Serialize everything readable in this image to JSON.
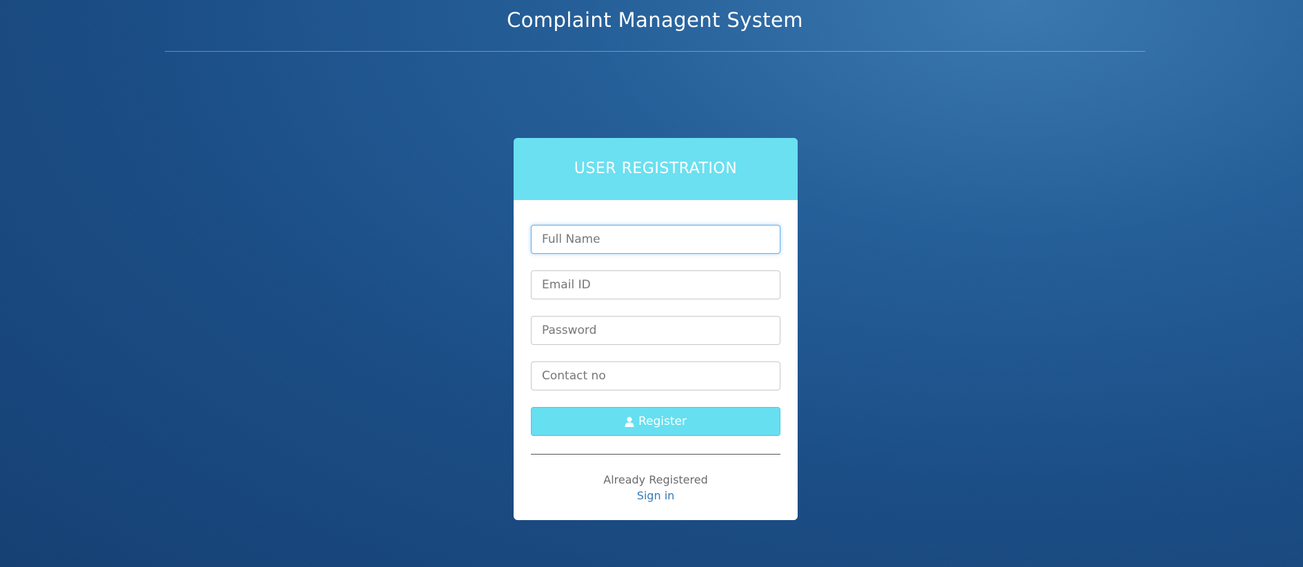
{
  "header": {
    "title": "Complaint Managent System"
  },
  "card": {
    "title": "USER REGISTRATION",
    "fields": {
      "full_name": {
        "placeholder": "Full Name",
        "value": ""
      },
      "email": {
        "placeholder": "Email ID",
        "value": ""
      },
      "password": {
        "placeholder": "Password",
        "value": ""
      },
      "contact": {
        "placeholder": "Contact no",
        "value": ""
      }
    },
    "register_label": "Register",
    "register_icon": "user-icon",
    "already_text": "Already Registered",
    "signin_label": "Sign in"
  },
  "colors": {
    "accent": "#6ae0f1",
    "link": "#337ab7",
    "background": "#1a4d85"
  }
}
